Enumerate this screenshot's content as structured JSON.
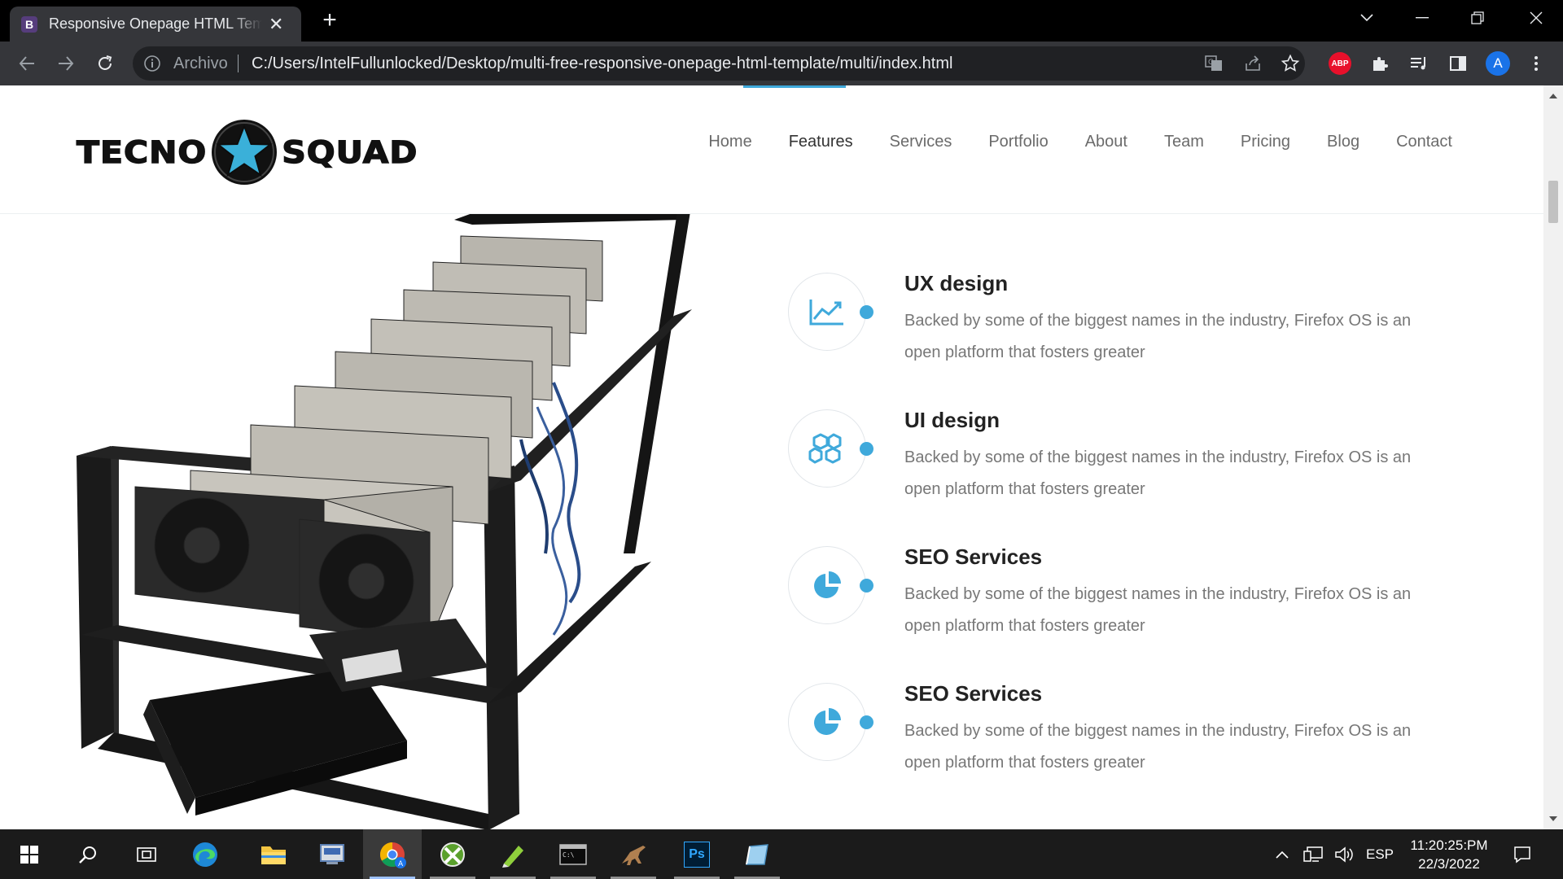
{
  "browser": {
    "tab_title": "Responsive Onepage HTML Template",
    "tab_favicon_letter": "B",
    "address_scheme": "Archivo",
    "address_url": "C:/Users/IntelFullunlocked/Desktop/multi-free-responsive-onepage-html-template/multi/index.html",
    "extension_abp": "ABP",
    "profile_initial": "A"
  },
  "site": {
    "logo_left": "TECNO",
    "logo_right": "SQUAD",
    "nav": [
      {
        "label": "Home"
      },
      {
        "label": "Features",
        "active": true
      },
      {
        "label": "Services"
      },
      {
        "label": "Portfolio"
      },
      {
        "label": "About"
      },
      {
        "label": "Team"
      },
      {
        "label": "Pricing"
      },
      {
        "label": "Blog"
      },
      {
        "label": "Contact"
      }
    ],
    "accent_color": "#3fa9db",
    "features": [
      {
        "icon": "line-chart-icon",
        "title": "UX design",
        "text": "Backed by some of the biggest names in the industry, Firefox OS is an open platform that fosters greater"
      },
      {
        "icon": "cubes-icon",
        "title": "UI design",
        "text": "Backed by some of the biggest names in the industry, Firefox OS is an open platform that fosters greater"
      },
      {
        "icon": "pie-chart-icon",
        "title": "SEO Services",
        "text": "Backed by some of the biggest names in the industry, Firefox OS is an open platform that fosters greater"
      },
      {
        "icon": "pie-chart-icon",
        "title": "SEO Services",
        "text": "Backed by some of the biggest names in the industry, Firefox OS is an open platform that fosters greater"
      }
    ]
  },
  "taskbar": {
    "apps": [
      "start-icon",
      "search-icon",
      "task-view-icon",
      "edge-icon",
      "file-explorer-icon",
      "app-icon",
      "chrome-icon",
      "xbox-app-icon",
      "notepad-app-icon",
      "terminal-icon",
      "dino-app-icon",
      "photoshop-icon",
      "app-icon"
    ],
    "photoshop_label": "Ps",
    "language": "ESP",
    "time": "11:20:25:PM",
    "date": "22/3/2022"
  }
}
